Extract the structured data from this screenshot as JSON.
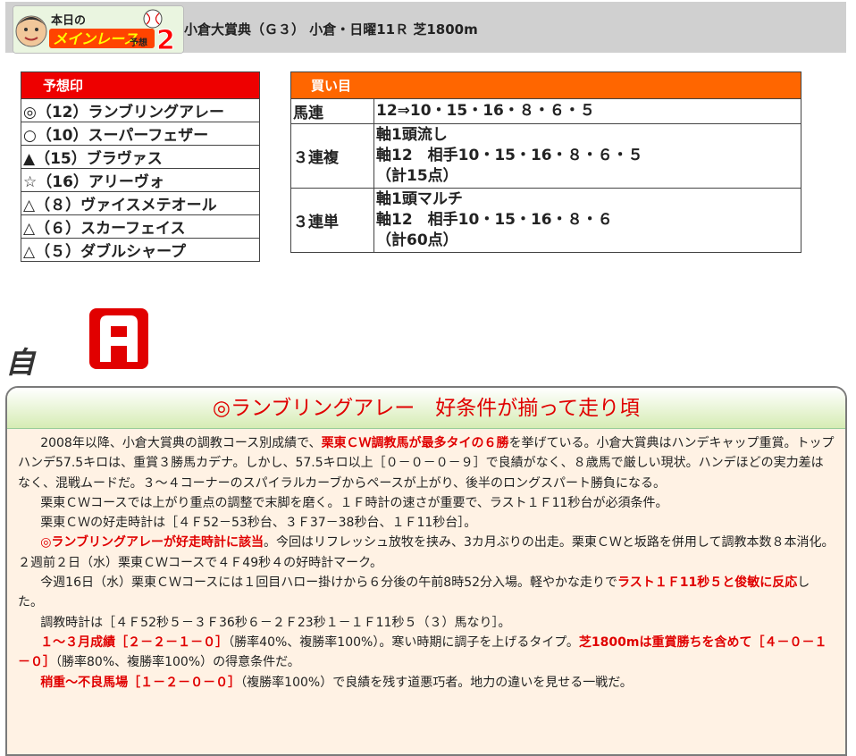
{
  "header": {
    "logo_text": "本日のメインレース予想2",
    "race_title": "小倉大賞典（Ｇ３） 小倉・日曜11Ｒ 芝1800m"
  },
  "yoso": {
    "heading": "予想印",
    "rows": [
      "◎（12）ランブリングアレー",
      "○（10）スーパーフェザー",
      "▲（15）ブラヴァス",
      "☆（16）アリーヴォ",
      "△（８）ヴァイスメテオール",
      "△（６）スカーフェイス",
      "△（５）ダブルシャープ"
    ]
  },
  "kaime": {
    "heading": "買い目",
    "rows": [
      {
        "type": "馬連",
        "lines": [
          "12⇒10・15・16・８・６・５"
        ]
      },
      {
        "type": "３連複",
        "lines": [
          "軸1頭流し",
          "軸12　相手10・15・16・８・６・５",
          "（計15点）"
        ]
      },
      {
        "type": "３連単",
        "lines": [
          "軸1頭マルチ",
          "軸12　相手10・15・16・８・６",
          "（計60点）"
        ]
      }
    ]
  },
  "confidence": {
    "label": "自信度",
    "rank": "A"
  },
  "comment": {
    "heading": "◎ランブリングアレー　好条件が揃って走り頃",
    "p1": {
      "a": "2008年以降、小倉大賞典の調教コース別成績で、",
      "b": "栗東ＣＷ調教馬が最多タイの６勝",
      "c": "を挙げている。小倉大賞典はハンデキャップ重賞。トップハンデ57.5キロは、重賞３勝馬カデナ。しかし、57.5キロ以上［０－０－０－９］で良績がなく、８歳馬で厳しい現状。ハンデほどの実力差はなく、混戦ムードだ。３～４コーナーのスパイラルカーブからペースが上がり、後半のロングスパート勝負になる。"
    },
    "p2": "栗東ＣＷコースでは上がり重点の調整で末脚を磨く。１Ｆ時計の速さが重要で、ラスト１Ｆ11秒台が必須条件。",
    "p3": "栗東ＣＷの好走時計は［４Ｆ52－53秒台、３Ｆ37－38秒台、１Ｆ11秒台］。",
    "p4": {
      "a": "◎ランブリングアレーが好走時計に該当",
      "b": "。今回はリフレッシュ放牧を挟み、3カ月ぶりの出走。栗東ＣＷと坂路を併用して調教本数８本消化。２週前２日（水）栗東ＣＷコースで４Ｆ49秒４の好時計マーク。"
    },
    "p5": {
      "a": "今週16日（水）栗東ＣＷコースには１回目ハロー掛けから６分後の午前8時52分入場。軽やかな走りで",
      "b": "ラスト１Ｆ11秒５と俊敏に反応",
      "c": "した。"
    },
    "p6": "調教時計は［４Ｆ52秒５－３Ｆ36秒６－２Ｆ23秒１－１Ｆ11秒５（３）馬なり］。",
    "p7": {
      "a": "１～３月成績［２－２－１－０］",
      "b": "（勝率40%、複勝率100%）。寒い時期に調子を上げるタイプ。",
      "c": "芝1800mは重賞勝ちを含めて［４－０－１－０］",
      "d": "（勝率80%、複勝率100%）の得意条件だ。"
    },
    "p8": {
      "a": "稍重～不良馬場［１－２－０－０］",
      "b": "（複勝率100%）で良績を残す道悪巧者。地力の違いを見せる一戦だ。"
    }
  }
}
